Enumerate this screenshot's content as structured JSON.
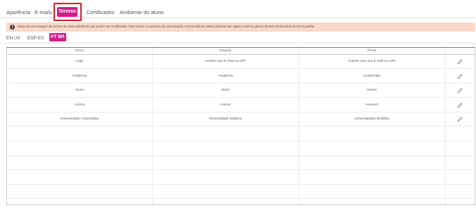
{
  "tabs": [
    "Aparência",
    "E-mails",
    "Termos",
    "Certificados",
    "Ambiente do aluno"
  ],
  "active_tab": "Termos",
  "alert": {
    "icon": "info-icon",
    "text": "Abaixo há uma listagem de termos da nossa plataforma que podem ser modificados. Para manter a coerência da comunicação, recomendamos utilizar palavras que sigam o mesmo gênero (feminino/masculino) do termo padrão."
  },
  "languages": [
    "EN US",
    "ESP ES",
    "PT BR"
  ],
  "active_language": "PT BR",
  "table": {
    "columns": [
      "Termo",
      "Singular",
      "Plural"
    ],
    "rows": [
      {
        "termo": "Login",
        "singular": "Acesse com E-mail ou CPF",
        "plural": "Acesse com seu E-mail ou CPF"
      },
      {
        "termo": "Academia",
        "singular": "Academia",
        "plural": "Academias"
      },
      {
        "termo": "Aluno",
        "singular": "Aluno",
        "plural": "Alunos"
      },
      {
        "termo": "Acervo",
        "singular": "Acervo",
        "plural": "Acervos"
      },
      {
        "termo": "Universidade Corporativa",
        "singular": "Universidade Mobiliza",
        "plural": "Universidades Mobiliza"
      }
    ],
    "empty_rows": 5
  },
  "colors": {
    "accent": "#cc1f8f",
    "highlight": "#d81b29",
    "alert_bg": "#fbd9c7"
  }
}
